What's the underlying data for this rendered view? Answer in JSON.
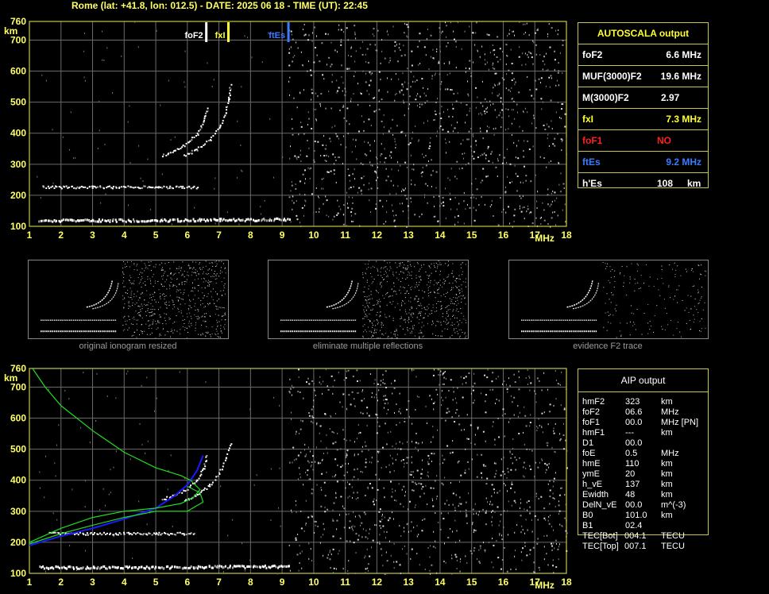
{
  "header": "Rome (lat: +41.8, lon: 012.5) - DATE: 2025 06 18 - TIME (UT): 22:45",
  "colors": {
    "grid": "#6b6b6b",
    "frame": "#c8c84a",
    "foF2": "#ffffff",
    "fxI": "#ffff33",
    "ftEs": "#3b7bff",
    "foF1": "#ff2020",
    "profile": "#1a1aff",
    "green": "#22dd22"
  },
  "chart_data": [
    {
      "type": "scatter",
      "panel": "top",
      "title": "",
      "xlabel": "MHz",
      "ylabel": "km",
      "xlim": [
        1,
        18
      ],
      "ylim": [
        100,
        760
      ],
      "x_ticks": [
        "1",
        "2",
        "3",
        "4",
        "5",
        "6",
        "7",
        "8",
        "9",
        "10",
        "11",
        "12",
        "13",
        "14",
        "15",
        "16",
        "17",
        "18"
      ],
      "y_ticks": [
        "100",
        "200",
        "300",
        "400",
        "500",
        "600",
        "700",
        "760"
      ],
      "markers": [
        {
          "name": "foF2",
          "x": 6.6
        },
        {
          "name": "fxI",
          "x": 7.3
        },
        {
          "name": "ftEs",
          "x": 9.2
        }
      ],
      "traces": [
        {
          "name": "F2 trace o",
          "points": [
            [
              5.2,
              330
            ],
            [
              5.6,
              345
            ],
            [
              6.0,
              370
            ],
            [
              6.3,
              400
            ],
            [
              6.5,
              440
            ],
            [
              6.6,
              480
            ]
          ]
        },
        {
          "name": "F2 trace x",
          "points": [
            [
              5.9,
              330
            ],
            [
              6.3,
              350
            ],
            [
              6.7,
              380
            ],
            [
              7.0,
              420
            ],
            [
              7.2,
              470
            ],
            [
              7.3,
              510
            ],
            [
              7.35,
              555
            ]
          ]
        },
        {
          "name": "Es 2nd",
          "points": [
            [
              1.4,
              228
            ],
            [
              3,
              228
            ],
            [
              5,
              228
            ],
            [
              6.3,
              228
            ]
          ]
        },
        {
          "name": "Es",
          "points": [
            [
              1.3,
              122
            ],
            [
              3,
              122
            ],
            [
              5,
              122
            ],
            [
              7,
              124
            ],
            [
              9.2,
              125
            ]
          ]
        }
      ]
    },
    {
      "type": "scatter",
      "panel": "bottom",
      "title": "",
      "xlabel": "MHz",
      "ylabel": "km",
      "xlim": [
        1,
        18
      ],
      "ylim": [
        100,
        760
      ],
      "x_ticks": [
        "1",
        "2",
        "3",
        "4",
        "5",
        "6",
        "7",
        "8",
        "9",
        "10",
        "11",
        "12",
        "13",
        "14",
        "15",
        "16",
        "17",
        "18"
      ],
      "y_ticks": [
        "100",
        "200",
        "300",
        "400",
        "500",
        "600",
        "700",
        "760"
      ],
      "traces": [
        {
          "name": "F2 trace o",
          "points": [
            [
              5.2,
              340
            ],
            [
              5.6,
              355
            ],
            [
              6.0,
              375
            ],
            [
              6.3,
              405
            ],
            [
              6.5,
              440
            ],
            [
              6.6,
              480
            ]
          ]
        },
        {
          "name": "F2 trace x",
          "points": [
            [
              5.9,
              335
            ],
            [
              6.3,
              355
            ],
            [
              6.7,
              385
            ],
            [
              7.0,
              425
            ],
            [
              7.2,
              470
            ],
            [
              7.35,
              520
            ]
          ]
        },
        {
          "name": "Es 2nd",
          "points": [
            [
              1.6,
              230
            ],
            [
              3,
              230
            ],
            [
              5,
              230
            ],
            [
              6.2,
              230
            ]
          ]
        },
        {
          "name": "Es",
          "points": [
            [
              1.3,
              122
            ],
            [
              3,
              122
            ],
            [
              5,
              122
            ],
            [
              7,
              124
            ],
            [
              9.2,
              125
            ]
          ]
        }
      ],
      "lines": [
        {
          "name": "profile",
          "points": [
            [
              1,
              190
            ],
            [
              2,
              220
            ],
            [
              3,
              245
            ],
            [
              4,
              275
            ],
            [
              5,
              310
            ],
            [
              5.6,
              350
            ],
            [
              6.0,
              385
            ],
            [
              6.3,
              430
            ],
            [
              6.5,
              480
            ]
          ]
        },
        {
          "name": "green-a",
          "points": [
            [
              1.1,
              760
            ],
            [
              1.5,
              700
            ],
            [
              2,
              640
            ],
            [
              3,
              560
            ],
            [
              4,
              490
            ],
            [
              5,
              440
            ],
            [
              5.8,
              415
            ],
            [
              6.1,
              400
            ],
            [
              6.4,
              370
            ],
            [
              6.2,
              345
            ],
            [
              5.8,
              325
            ],
            [
              5,
              310
            ],
            [
              4,
              300
            ],
            [
              3,
              280
            ],
            [
              2,
              245
            ],
            [
              1,
              200
            ]
          ]
        },
        {
          "name": "green-b",
          "points": [
            [
              1,
              195
            ],
            [
              2,
              228
            ],
            [
              3,
              255
            ],
            [
              4,
              280
            ],
            [
              5,
              300
            ],
            [
              6,
              300
            ],
            [
              6.5,
              330
            ],
            [
              6.4,
              360
            ],
            [
              6,
              380
            ]
          ]
        }
      ]
    }
  ],
  "autoscala": {
    "title": "AUTOSCALA output",
    "rows": [
      {
        "label": "foF2",
        "value": "6.6 MHz",
        "color": "#ffffff"
      },
      {
        "label": "MUF(3000)F2",
        "value": "19.6 MHz",
        "color": "#ffffff"
      },
      {
        "label": "M(3000)F2",
        "value": "2.97",
        "color": "#ffffff"
      },
      {
        "label": "fxI",
        "value": "7.3 MHz",
        "color": "#ffff33"
      },
      {
        "label": "foF1",
        "value": "NO",
        "color": "#ff2020"
      },
      {
        "label": "ftEs",
        "value": "9.2 MHz",
        "color": "#3b7bff"
      },
      {
        "label": "h'Es",
        "value": "108",
        "unit": "km",
        "color": "#ffffff"
      }
    ]
  },
  "thumbnails": [
    {
      "caption": "original ionogram resized"
    },
    {
      "caption": "eliminate multiple reflections"
    },
    {
      "caption": "evidence F2 trace"
    }
  ],
  "aip": {
    "title": "AIP output",
    "rows": [
      {
        "label": "hmF2",
        "value": "323",
        "unit": "km"
      },
      {
        "label": "foF2",
        "value": "06.6",
        "unit": "MHz"
      },
      {
        "label": "foF1",
        "value": "00.0",
        "unit": "MHz  [PN]"
      },
      {
        "label": "hmF1",
        "value": "---",
        "unit": "km"
      },
      {
        "label": "D1",
        "value": "00.0",
        "unit": ""
      },
      {
        "label": "foE",
        "value": "0.5",
        "unit": "MHz"
      },
      {
        "label": "hmE",
        "value": "110",
        "unit": "km"
      },
      {
        "label": "ymE",
        "value": "20",
        "unit": "km"
      },
      {
        "label": "h_vE",
        "value": "137",
        "unit": "km"
      },
      {
        "label": "Ewidth",
        "value": "48",
        "unit": "km"
      },
      {
        "label": "DelN_vE",
        "value": "00.0",
        "unit": "m^(-3)"
      },
      {
        "label": "B0",
        "value": "101.0",
        "unit": "km"
      },
      {
        "label": "B1",
        "value": "02.4",
        "unit": ""
      },
      {
        "label": "TEC[Bot]",
        "value": "004.1",
        "unit": "TECU"
      },
      {
        "label": "TEC[Top]",
        "value": "007.1",
        "unit": "TECU"
      }
    ]
  }
}
